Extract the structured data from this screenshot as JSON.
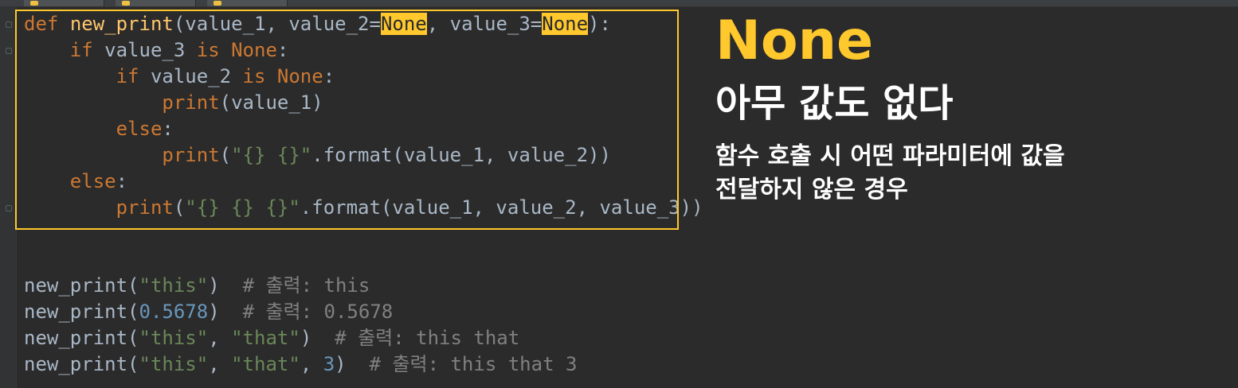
{
  "editor": {
    "code": [
      {
        "indent": "",
        "parts": [
          {
            "t": "def",
            "c": "kw"
          },
          {
            "t": " ",
            "c": ""
          },
          {
            "t": "new_print",
            "c": "fn"
          },
          {
            "t": "(value_1, value_2=",
            "c": ""
          },
          {
            "t": "None",
            "c": "hl"
          },
          {
            "t": ", value_3=",
            "c": ""
          },
          {
            "t": "None",
            "c": "hl"
          },
          {
            "t": "):",
            "c": ""
          }
        ]
      },
      {
        "indent": "    ",
        "parts": [
          {
            "t": "if",
            "c": "kw"
          },
          {
            "t": " value_3 ",
            "c": ""
          },
          {
            "t": "is None",
            "c": "kw"
          },
          {
            "t": ":",
            "c": ""
          }
        ]
      },
      {
        "indent": "        ",
        "parts": [
          {
            "t": "if",
            "c": "kw"
          },
          {
            "t": " value_2 ",
            "c": ""
          },
          {
            "t": "is None",
            "c": "kw"
          },
          {
            "t": ":",
            "c": ""
          }
        ]
      },
      {
        "indent": "            ",
        "parts": [
          {
            "t": "print",
            "c": "kw"
          },
          {
            "t": "(value_1)",
            "c": ""
          }
        ]
      },
      {
        "indent": "        ",
        "parts": [
          {
            "t": "else",
            "c": "kw"
          },
          {
            "t": ":",
            "c": ""
          }
        ]
      },
      {
        "indent": "            ",
        "parts": [
          {
            "t": "print",
            "c": "kw"
          },
          {
            "t": "(",
            "c": ""
          },
          {
            "t": "\"{} {}\"",
            "c": "str"
          },
          {
            "t": ".format(value_1, value_2))",
            "c": ""
          }
        ]
      },
      {
        "indent": "    ",
        "parts": [
          {
            "t": "else",
            "c": "kw"
          },
          {
            "t": ":",
            "c": ""
          }
        ]
      },
      {
        "indent": "        ",
        "parts": [
          {
            "t": "print",
            "c": "kw"
          },
          {
            "t": "(",
            "c": ""
          },
          {
            "t": "\"{} {} {}\"",
            "c": "str"
          },
          {
            "t": ".format(value_1, value_2, value_3))",
            "c": ""
          }
        ]
      }
    ],
    "usage": [
      {
        "indent": "",
        "parts": [
          {
            "t": "new_print(",
            "c": ""
          },
          {
            "t": "\"this\"",
            "c": "str"
          },
          {
            "t": ")  ",
            "c": ""
          },
          {
            "t": "# 출력: this",
            "c": "cmt"
          }
        ]
      },
      {
        "indent": "",
        "parts": [
          {
            "t": "new_print(",
            "c": ""
          },
          {
            "t": "0.5678",
            "c": "num"
          },
          {
            "t": ")  ",
            "c": ""
          },
          {
            "t": "# 출력: 0.5678",
            "c": "cmt"
          }
        ]
      },
      {
        "indent": "",
        "parts": [
          {
            "t": "new_print(",
            "c": ""
          },
          {
            "t": "\"this\"",
            "c": "str"
          },
          {
            "t": ", ",
            "c": ""
          },
          {
            "t": "\"that\"",
            "c": "str"
          },
          {
            "t": ")  ",
            "c": ""
          },
          {
            "t": "# 출력: this that",
            "c": "cmt"
          }
        ]
      },
      {
        "indent": "",
        "parts": [
          {
            "t": "new_print(",
            "c": ""
          },
          {
            "t": "\"this\"",
            "c": "str"
          },
          {
            "t": ", ",
            "c": ""
          },
          {
            "t": "\"that\"",
            "c": "str"
          },
          {
            "t": ", ",
            "c": ""
          },
          {
            "t": "3",
            "c": "num"
          },
          {
            "t": ")  ",
            "c": ""
          },
          {
            "t": "# 출력: this that 3",
            "c": "cmt"
          }
        ]
      }
    ]
  },
  "annotation": {
    "title": "None",
    "subtitle": "아무 값도 없다",
    "desc_line1": "함수 호출 시 어떤 파라미터에 값을",
    "desc_line2": "전달하지 않은 경우"
  },
  "colors": {
    "background": "#2b2b2b",
    "highlight": "#ffc82c",
    "keyword": "#cc7832",
    "function": "#ffc66d",
    "string": "#6a8759",
    "number": "#6897bb",
    "comment": "#808080"
  },
  "icons": {
    "tab": "python-file-icon",
    "gutter": "fold-marker-icon"
  }
}
